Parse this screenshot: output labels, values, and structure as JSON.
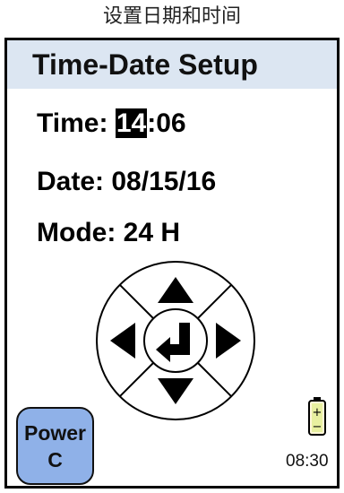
{
  "caption": "设置日期和时间",
  "screen": {
    "title": "Time-Date Setup",
    "time": {
      "label": "Time:",
      "hours": "14",
      "separator": ":",
      "minutes": "06"
    },
    "date": {
      "label": "Date:",
      "value": "08/15/16"
    },
    "mode": {
      "label": "Mode:",
      "value": "24 H"
    },
    "nav_pad": {
      "up": "arrow-up-icon",
      "down": "arrow-down-icon",
      "left": "arrow-left-icon",
      "right": "arrow-right-icon",
      "center": "enter-return-icon"
    },
    "power_button": {
      "line1": "Power",
      "line2": "C"
    },
    "battery": {
      "icon": "battery-icon",
      "plus": "+",
      "minus": "−"
    },
    "clock": "08:30"
  },
  "colors": {
    "title_bar": "#dce6f2",
    "power_button": "#8fb1e8",
    "highlight": "#000000"
  }
}
